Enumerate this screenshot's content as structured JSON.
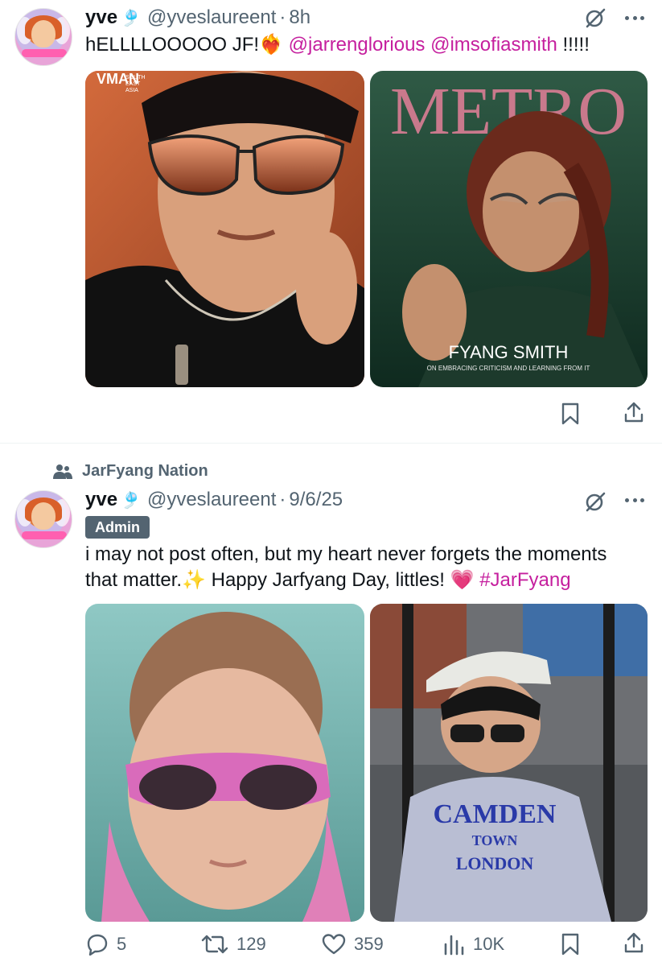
{
  "tweet1": {
    "author_name": "yve",
    "author_glyph": "🎐",
    "handle": "@yveslaureent",
    "separator": "·",
    "time": "8h",
    "text_prefix": "hELLLLOOOOO JF!",
    "text_emoji": "❤️‍🔥",
    "mention1": "@jarrenglorious",
    "mention2": "@imsofiasmith",
    "text_suffix": "!!!!!",
    "media_left": {
      "icon": "magazine-cover-photo",
      "magazine_label": "VMAN",
      "magazine_sublabel_1": "SOUTH",
      "magazine_sublabel_2": "EAST",
      "magazine_sublabel_3": "ASIA"
    },
    "media_right": {
      "icon": "magazine-cover-photo",
      "masthead": "METRO",
      "cover_name": "FYANG SMITH",
      "cover_tagline": "ON EMBRACING CRITICISM AND LEARNING FROM IT"
    },
    "actions": {
      "bookmark_icon": "bookmark-icon",
      "share_icon": "share-icon"
    }
  },
  "tweet2": {
    "community": "JarFyang Nation",
    "community_icon": "community-icon",
    "author_name": "yve",
    "author_glyph": "🎐",
    "handle": "@yveslaureent",
    "separator": "·",
    "time": "9/6/25",
    "badge": "Admin",
    "text_line1": "i may not post often, but my heart never forgets the moments",
    "text_line2_prefix": "that matter.",
    "sparkles": "✨",
    "text_line2_mid": "Happy Jarfyang Day, littles!",
    "heart": "💗",
    "hashtag": "#JarFyang",
    "media_left": {
      "icon": "child-sunglasses-photo"
    },
    "media_right": {
      "icon": "child-hoodie-photo",
      "hoodie_line1": "CAMDEN",
      "hoodie_line2": "TOWN",
      "hoodie_line3": "LONDON"
    },
    "actions": {
      "replies": "5",
      "reposts": "129",
      "likes": "359",
      "views": "10K"
    }
  },
  "colors": {
    "text": "#0f1419",
    "muted": "#536471",
    "accent_pink": "#c51f9e",
    "divider": "#eff3f4"
  }
}
